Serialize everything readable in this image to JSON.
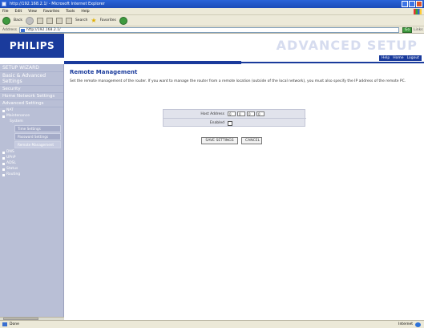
{
  "window": {
    "title": "http://192.168.2.1/ - Microsoft Internet Explorer"
  },
  "menubar": {
    "items": [
      "File",
      "Edit",
      "View",
      "Favorites",
      "Tools",
      "Help"
    ]
  },
  "toolbar": {
    "back_label": "Back",
    "search_label": "Search",
    "favorites_label": "Favorites"
  },
  "address": {
    "label": "Address",
    "value": "http://192.168.2.1/",
    "go_label": "Go",
    "links_label": "Links"
  },
  "header": {
    "logo": "PHILIPS",
    "title": "ADVANCED SETUP",
    "links": [
      "Help",
      "Home",
      "Logout"
    ]
  },
  "sidebar": {
    "items": [
      {
        "label": "SETUP WIZARD",
        "level": 0
      },
      {
        "label": "Basic & Advanced Settings",
        "level": 0
      },
      {
        "label": "Security",
        "level": 0
      },
      {
        "label": "Home Network Settings",
        "level": 0
      },
      {
        "label": "Advanced Settings",
        "level": 0
      },
      {
        "label": "NAT",
        "level": 1
      },
      {
        "label": "Maintenance",
        "level": 1
      },
      {
        "label": "System",
        "level": 2
      },
      {
        "label": "Time Settings",
        "level": 3
      },
      {
        "label": "Password Settings",
        "level": 3
      },
      {
        "label": "Remote Management",
        "level": 3
      },
      {
        "label": "DNS",
        "level": 1
      },
      {
        "label": "UPnP",
        "level": 1
      },
      {
        "label": "ADSL",
        "level": 1
      },
      {
        "label": "Status",
        "level": 1
      },
      {
        "label": "Routing",
        "level": 1
      }
    ]
  },
  "main": {
    "title": "Remote Management",
    "description": "Set the remote management of the router. If you want to manage the router from a remote location (outside of the local network), you must also specify the IP address of the remote PC.",
    "form": {
      "host_label": "Host Address",
      "ip": [
        "0",
        "0",
        "0",
        "0"
      ],
      "enabled_label": "Enabled"
    },
    "buttons": {
      "save": "SAVE SETTINGS",
      "cancel": "CANCEL"
    }
  },
  "status": {
    "left": "Done",
    "right": "Internet"
  }
}
